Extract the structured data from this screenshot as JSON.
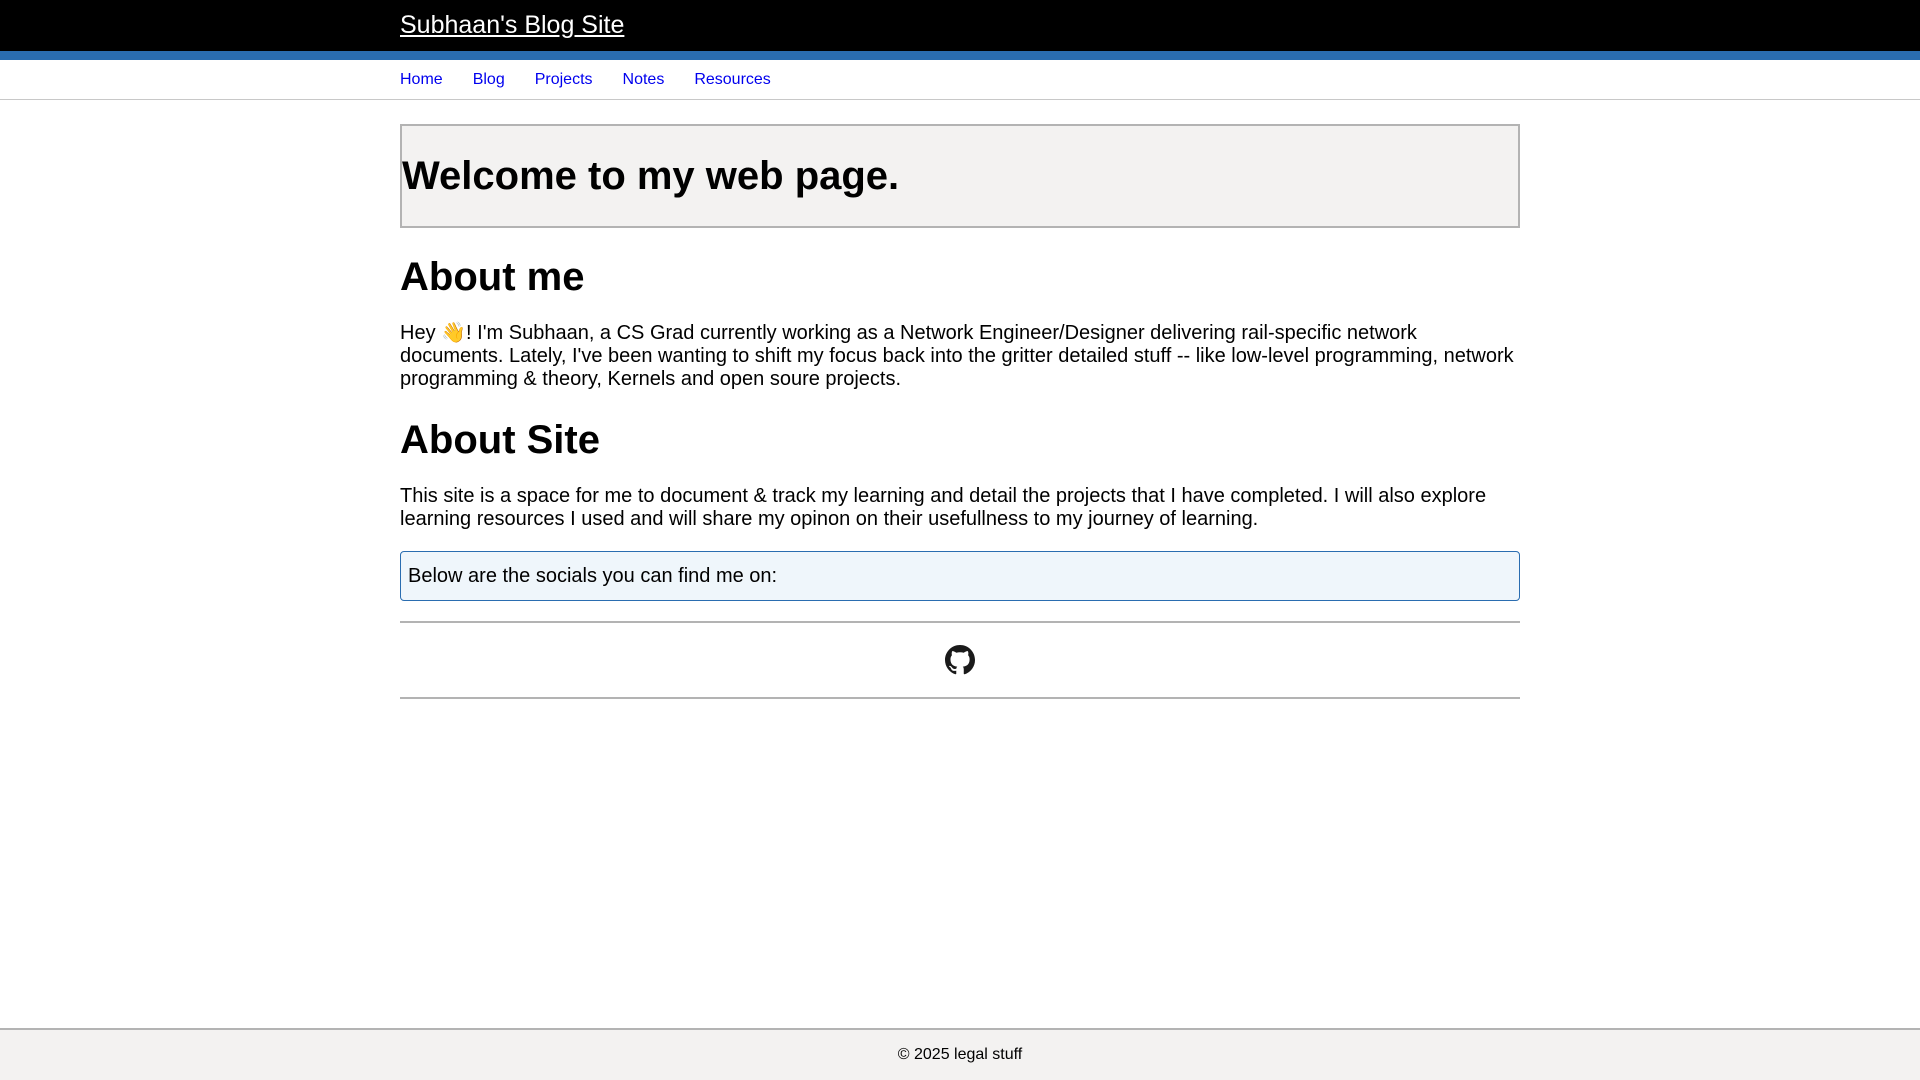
{
  "header": {
    "site_title": "Subhaan's Blog Site",
    "background_color": "#000000",
    "accent_color": "#2a6db0"
  },
  "nav": {
    "items": [
      {
        "label": "Home"
      },
      {
        "label": "Blog"
      },
      {
        "label": "Projects"
      },
      {
        "label": "Notes"
      },
      {
        "label": "Resources"
      }
    ],
    "link_color": "#0000ee"
  },
  "main": {
    "welcome_title": "Welcome to my web page.",
    "about_me": {
      "heading": "About me",
      "text_before_emoji": "Hey ",
      "emoji": "👋",
      "text_after_emoji": "! I'm Subhaan, a CS Grad currently working as a Network Engineer/Designer delivering rail-specific network documents. Lately, I've been wanting to shift my focus back into the gritter detailed stuff -- like low-level programming, network programming & theory, Kernels and open soure projects."
    },
    "about_site": {
      "heading": "About Site",
      "text": "This site is a space for me to document & track my learning and detail the projects that I have completed. I will also explore learning resources I used and will share my opinon on their usefullness to my journey of learning."
    },
    "socials": {
      "intro": "Below are the socials you can find me on:",
      "icons": [
        "github-icon"
      ]
    }
  },
  "footer": {
    "text": "© 2025 legal stuff"
  }
}
